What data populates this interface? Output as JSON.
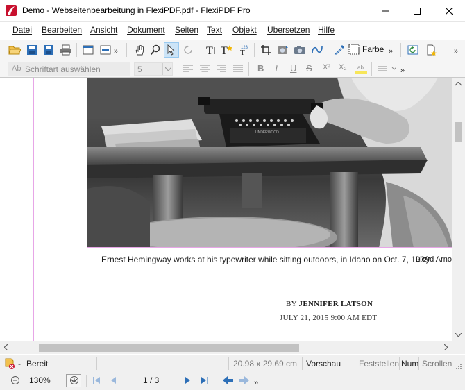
{
  "window": {
    "title": "Demo - Webseitenbearbeitung in FlexiPDF.pdf - FlexiPDF Pro"
  },
  "menu": {
    "items": [
      "Datei",
      "Bearbeiten",
      "Ansicht",
      "Dokument",
      "Seiten",
      "Text",
      "Objekt",
      "Übersetzen",
      "Hilfe"
    ]
  },
  "toolbar": {
    "color_label": "Farbe",
    "more": "»"
  },
  "format_bar": {
    "font_placeholder": "Schriftart auswählen",
    "font_icon": "Ab",
    "font_size": "5",
    "bold": "B",
    "italic": "I",
    "underline": "U",
    "strike": "S",
    "superscript": "X²",
    "subscript": "X₂",
    "more": "»"
  },
  "document": {
    "caption": "Ernest Hemingway works at his typewriter while sitting outdoors, in Idaho on Oct. 7, 1939",
    "credit": "Lloyd Arnol",
    "byline_prefix": "BY",
    "byline_author": "JENNIFER LATSON",
    "dateline": "JULY 21, 2015 9:00 AM EDT",
    "typewriter_brand": "UNDERWOOD"
  },
  "status": {
    "state": "Bereit",
    "dash": "-",
    "page_size": "20.98 x 29.69 cm",
    "mode": "Vorschau",
    "caps": "Feststellen",
    "num": "Num",
    "scroll": "Scrollen"
  },
  "navigation": {
    "zoom": "130%",
    "page_indicator": "1 / 3",
    "more": "»"
  },
  "colors": {
    "accent": "#0078d7",
    "logo_red": "#c8102e",
    "page_border": "#e7a6e7"
  }
}
